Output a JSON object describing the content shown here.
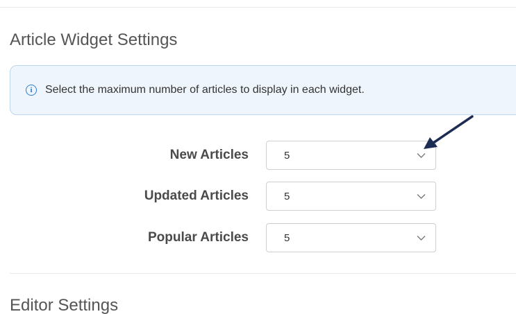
{
  "article_widget_settings": {
    "title": "Article Widget Settings",
    "info_message": "Select the maximum number of articles to display in each widget.",
    "fields": [
      {
        "label": "New Articles",
        "value": "5"
      },
      {
        "label": "Updated Articles",
        "value": "5"
      },
      {
        "label": "Popular Articles",
        "value": "5"
      }
    ]
  },
  "editor_settings": {
    "title": "Editor Settings"
  },
  "colors": {
    "info_accent": "#2b7bd0",
    "info_background": "#eef5fc",
    "annotation_arrow": "#1c2c52"
  },
  "icons": {
    "info": "info-circle-icon",
    "dropdown": "chevron-down-icon",
    "annotation": "pointer-arrow-icon"
  }
}
